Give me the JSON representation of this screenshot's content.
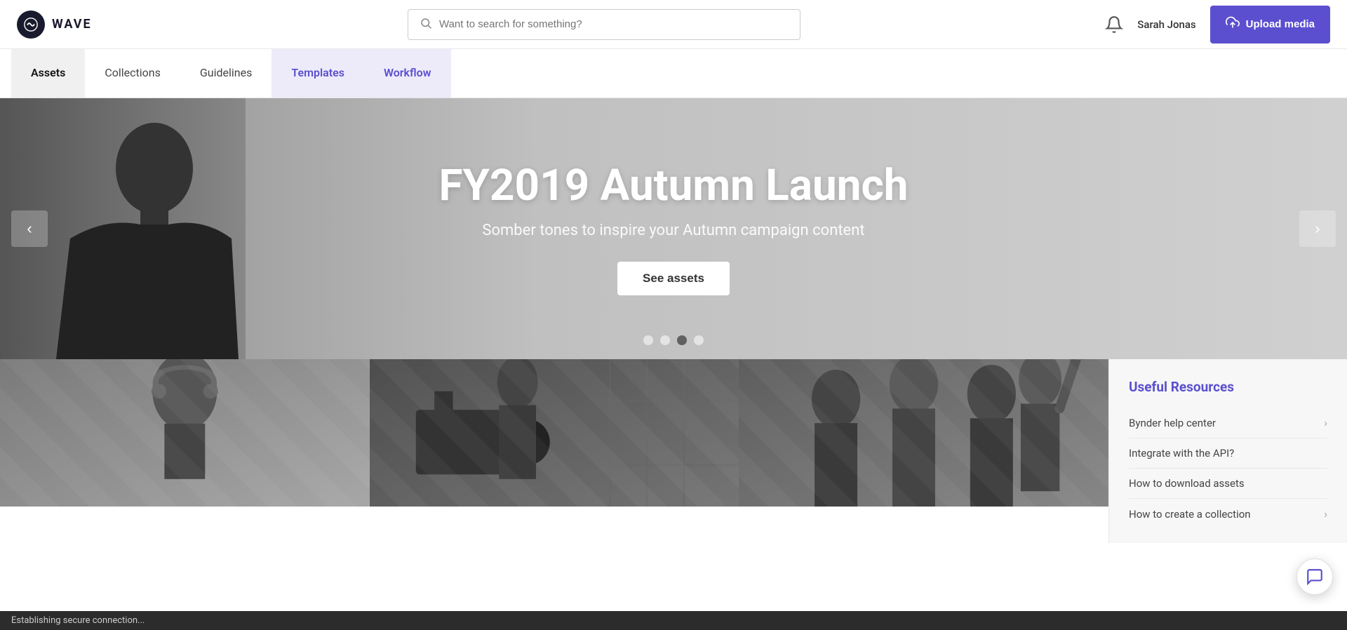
{
  "header": {
    "logo_text": "WAVE",
    "search_placeholder": "Want to search for something?",
    "user_name": "Sarah Jonas",
    "upload_btn_label": "Upload media"
  },
  "nav": {
    "items": [
      {
        "id": "assets",
        "label": "Assets",
        "state": "active"
      },
      {
        "id": "collections",
        "label": "Collections",
        "state": "default"
      },
      {
        "id": "guidelines",
        "label": "Guidelines",
        "state": "default"
      },
      {
        "id": "templates",
        "label": "Templates",
        "state": "highlighted"
      },
      {
        "id": "workflow",
        "label": "Workflow",
        "state": "highlighted"
      }
    ]
  },
  "hero": {
    "title": "FY2019 Autumn Launch",
    "subtitle": "Somber tones to inspire your Autumn campaign content",
    "cta_label": "See assets",
    "dots": [
      {
        "id": 1,
        "active": false
      },
      {
        "id": 2,
        "active": false
      },
      {
        "id": 3,
        "active": true
      },
      {
        "id": 4,
        "active": false
      }
    ]
  },
  "thumbnails": [
    {
      "id": 1,
      "alt": "Person with headphones"
    },
    {
      "id": 2,
      "alt": "Film crew with camera"
    },
    {
      "id": 3,
      "alt": "Person with phone"
    }
  ],
  "resources": {
    "title": "Useful Resources",
    "items": [
      {
        "id": "help",
        "label": "Bynder help center",
        "has_arrow": true
      },
      {
        "id": "api",
        "label": "Integrate with the API?",
        "has_arrow": false
      },
      {
        "id": "download",
        "label": "How to download assets",
        "has_arrow": false
      },
      {
        "id": "collection",
        "label": "How to create a collection",
        "has_arrow": true
      }
    ]
  },
  "status_bar": {
    "text": "Establishing secure connection..."
  },
  "colors": {
    "brand_purple": "#5b4fcf",
    "nav_highlight_bg": "#edebf9",
    "hero_bg": "#b8b8b8"
  }
}
